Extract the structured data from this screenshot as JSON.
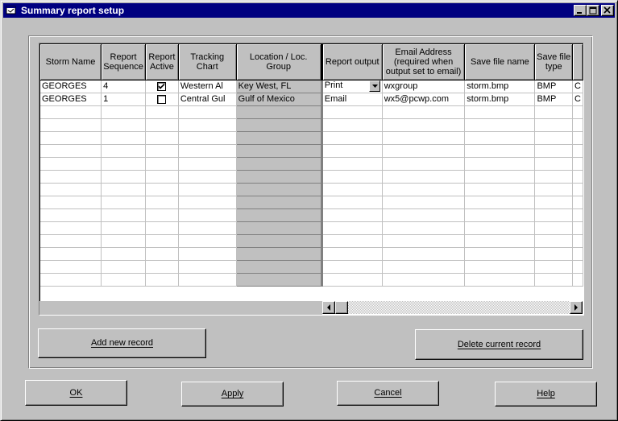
{
  "window": {
    "title": "Summary report setup"
  },
  "grid": {
    "columns": [
      "Storm Name",
      "Report Sequence",
      "Report Active",
      "Tracking Chart",
      "Location / Loc. Group",
      "Report output",
      "Email Address (required when output set to email)",
      "Save file name",
      "Save file type"
    ],
    "rows": [
      {
        "storm": "GEORGES",
        "sequence": "4",
        "active": true,
        "chart": "Western Al",
        "location": "Key West, FL",
        "output": "Print",
        "email": "wxgroup",
        "file": "storm.bmp",
        "type": "BMP",
        "extra": "C"
      },
      {
        "storm": "GEORGES",
        "sequence": "1",
        "active": false,
        "chart": "Central Gul",
        "location": "Gulf of Mexico",
        "output": "Email",
        "email": "wx5@pcwp.com",
        "file": "storm.bmp",
        "type": "BMP",
        "extra": "C"
      }
    ]
  },
  "buttons": {
    "add": "Add new record",
    "delete": "Delete current record",
    "ok": "OK",
    "apply": "Apply",
    "cancel": "Cancel",
    "help": "Help"
  }
}
